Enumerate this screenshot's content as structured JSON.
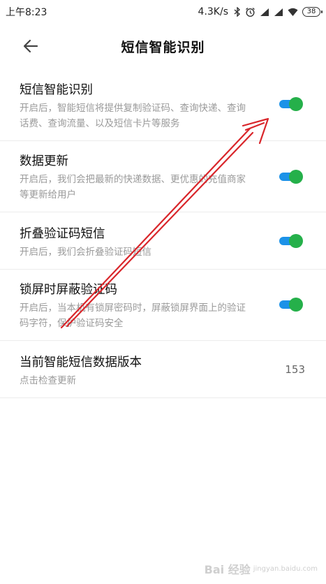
{
  "status_bar": {
    "time": "上午8:23",
    "network_speed": "4.3K/s",
    "battery_level": "38",
    "icons": [
      "bluetooth-icon",
      "alarm-icon",
      "signal-icon",
      "signal-icon",
      "wifi-icon",
      "battery-icon"
    ]
  },
  "header": {
    "title": "短信智能识别",
    "back_icon": "back-arrow-icon"
  },
  "settings": [
    {
      "title": "短信智能识别",
      "description": "开启后，智能短信将提供复制验证码、查询快递、查询话费、查询流量、以及短信卡片等服务",
      "toggle_on": true
    },
    {
      "title": "数据更新",
      "description": "开启后，我们会把最新的快递数据、更优惠的充值商家等更新给用户",
      "toggle_on": true
    },
    {
      "title": "折叠验证码短信",
      "description": "开启后，我们会折叠验证码短信",
      "toggle_on": true
    },
    {
      "title": "锁屏时屏蔽验证码",
      "description": "开启后，当本机有锁屏密码时，屏蔽锁屏界面上的验证码字符，保护验证码安全",
      "toggle_on": true
    },
    {
      "title": "当前智能短信数据版本",
      "description": "点击检查更新",
      "value": "153"
    }
  ],
  "colors": {
    "toggle_track": "#1c92e8",
    "toggle_knob": "#25b04a",
    "annotation_arrow": "#d9262b"
  },
  "watermark": {
    "text": "Bai 经验",
    "subtext": "jingyan.baidu.com"
  }
}
